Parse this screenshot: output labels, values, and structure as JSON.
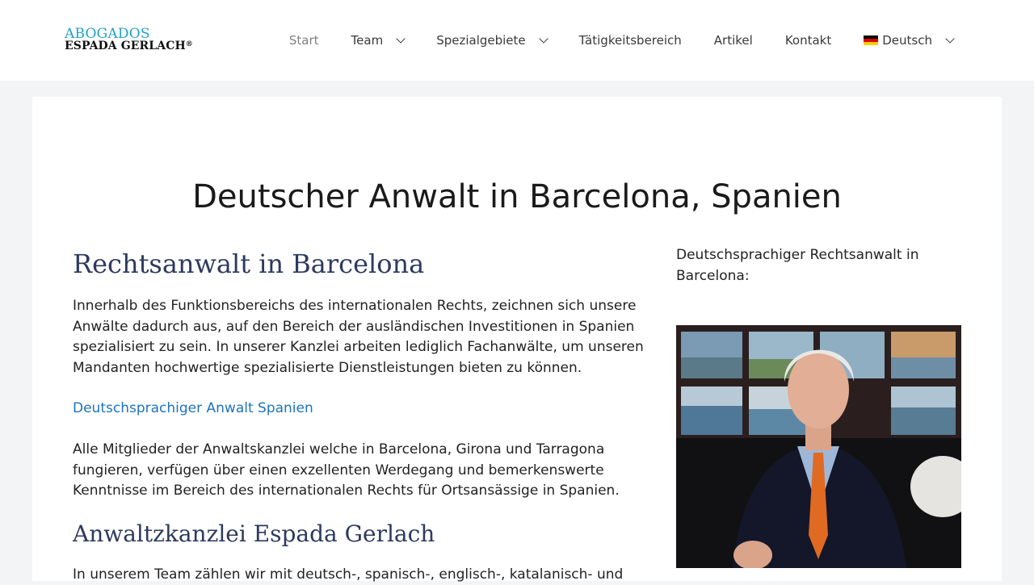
{
  "header": {
    "logo_top": "ABOGADOS",
    "logo_bottom": "ESPADA GERLACH",
    "logo_mark": "®",
    "nav": [
      {
        "label": "Start",
        "active": true
      },
      {
        "label": "Team",
        "dropdown": true
      },
      {
        "label": "Spezialgebiete",
        "dropdown": true
      },
      {
        "label": "Tätigkeitsbereich"
      },
      {
        "label": "Artikel"
      },
      {
        "label": "Kontakt"
      },
      {
        "label": "Deutsch",
        "dropdown": true,
        "icon": "germany-flag-icon"
      }
    ]
  },
  "main": {
    "title": "Deutscher Anwalt in Barcelona, Spanien",
    "h2_1": "Rechtsanwalt in Barcelona",
    "p1": "Innerhalb des Funktionsbereichs des internationalen Rechts, zeichnen sich unsere Anwälte dadurch aus, auf den Bereich der ausländischen Investitionen in Spanien spezialisiert zu sein. In unserer Kanzlei arbeiten lediglich Fachanwälte, um unseren Mandanten hochwertige spezialisierte Dienstleistungen bieten zu können.",
    "link1": "Deutschsprachiger Anwalt Spanien",
    "p2": "Alle Mitglieder der Anwaltskanzlei welche in Barcelona, Girona und Tarragona fungieren, verfügen über einen exzellenten Werdegang und bemerkenswerte Kenntnisse im Bereich des internationalen Rechts für Ortsansässige in Spanien.",
    "h2_2": "Anwaltzkanzlei Espada Gerlach",
    "p3": "In unserem Team zählen wir mit deutsch-, spanisch-, englisch-, katalanisch- und"
  },
  "sidebar": {
    "text": "Deutschsprachiger Rechtsanwalt in Barcelona:"
  },
  "colors": {
    "link": "#1e73be",
    "heading": "#2d3a5e",
    "logo_accent": "#1fa2c7",
    "page_bg": "#f3f4f6"
  }
}
